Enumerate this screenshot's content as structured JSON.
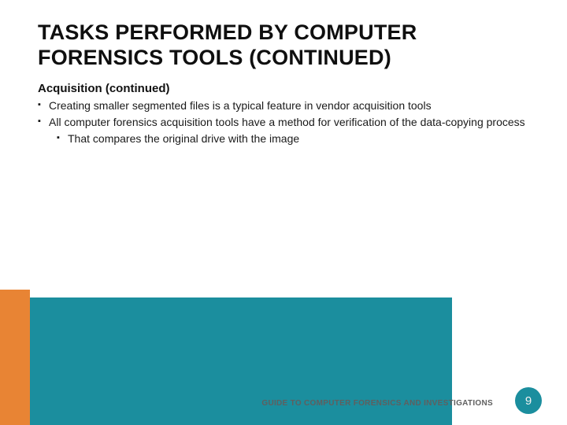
{
  "title": "TASKS PERFORMED BY COMPUTER FORENSICS TOOLS (CONTINUED)",
  "subheading": "Acquisition (continued)",
  "bullets": [
    {
      "text": "Creating smaller segmented files is a typical feature in vendor acquisition tools"
    },
    {
      "text": "All computer forensics acquisition tools have a method for verification of the data-copying process",
      "sub": [
        {
          "text": "That compares the original drive with the image"
        }
      ]
    }
  ],
  "footer": "GUIDE TO COMPUTER FORENSICS AND INVESTIGATIONS",
  "page_number": "9",
  "colors": {
    "orange": "#e88434",
    "teal": "#1b8e9e"
  }
}
